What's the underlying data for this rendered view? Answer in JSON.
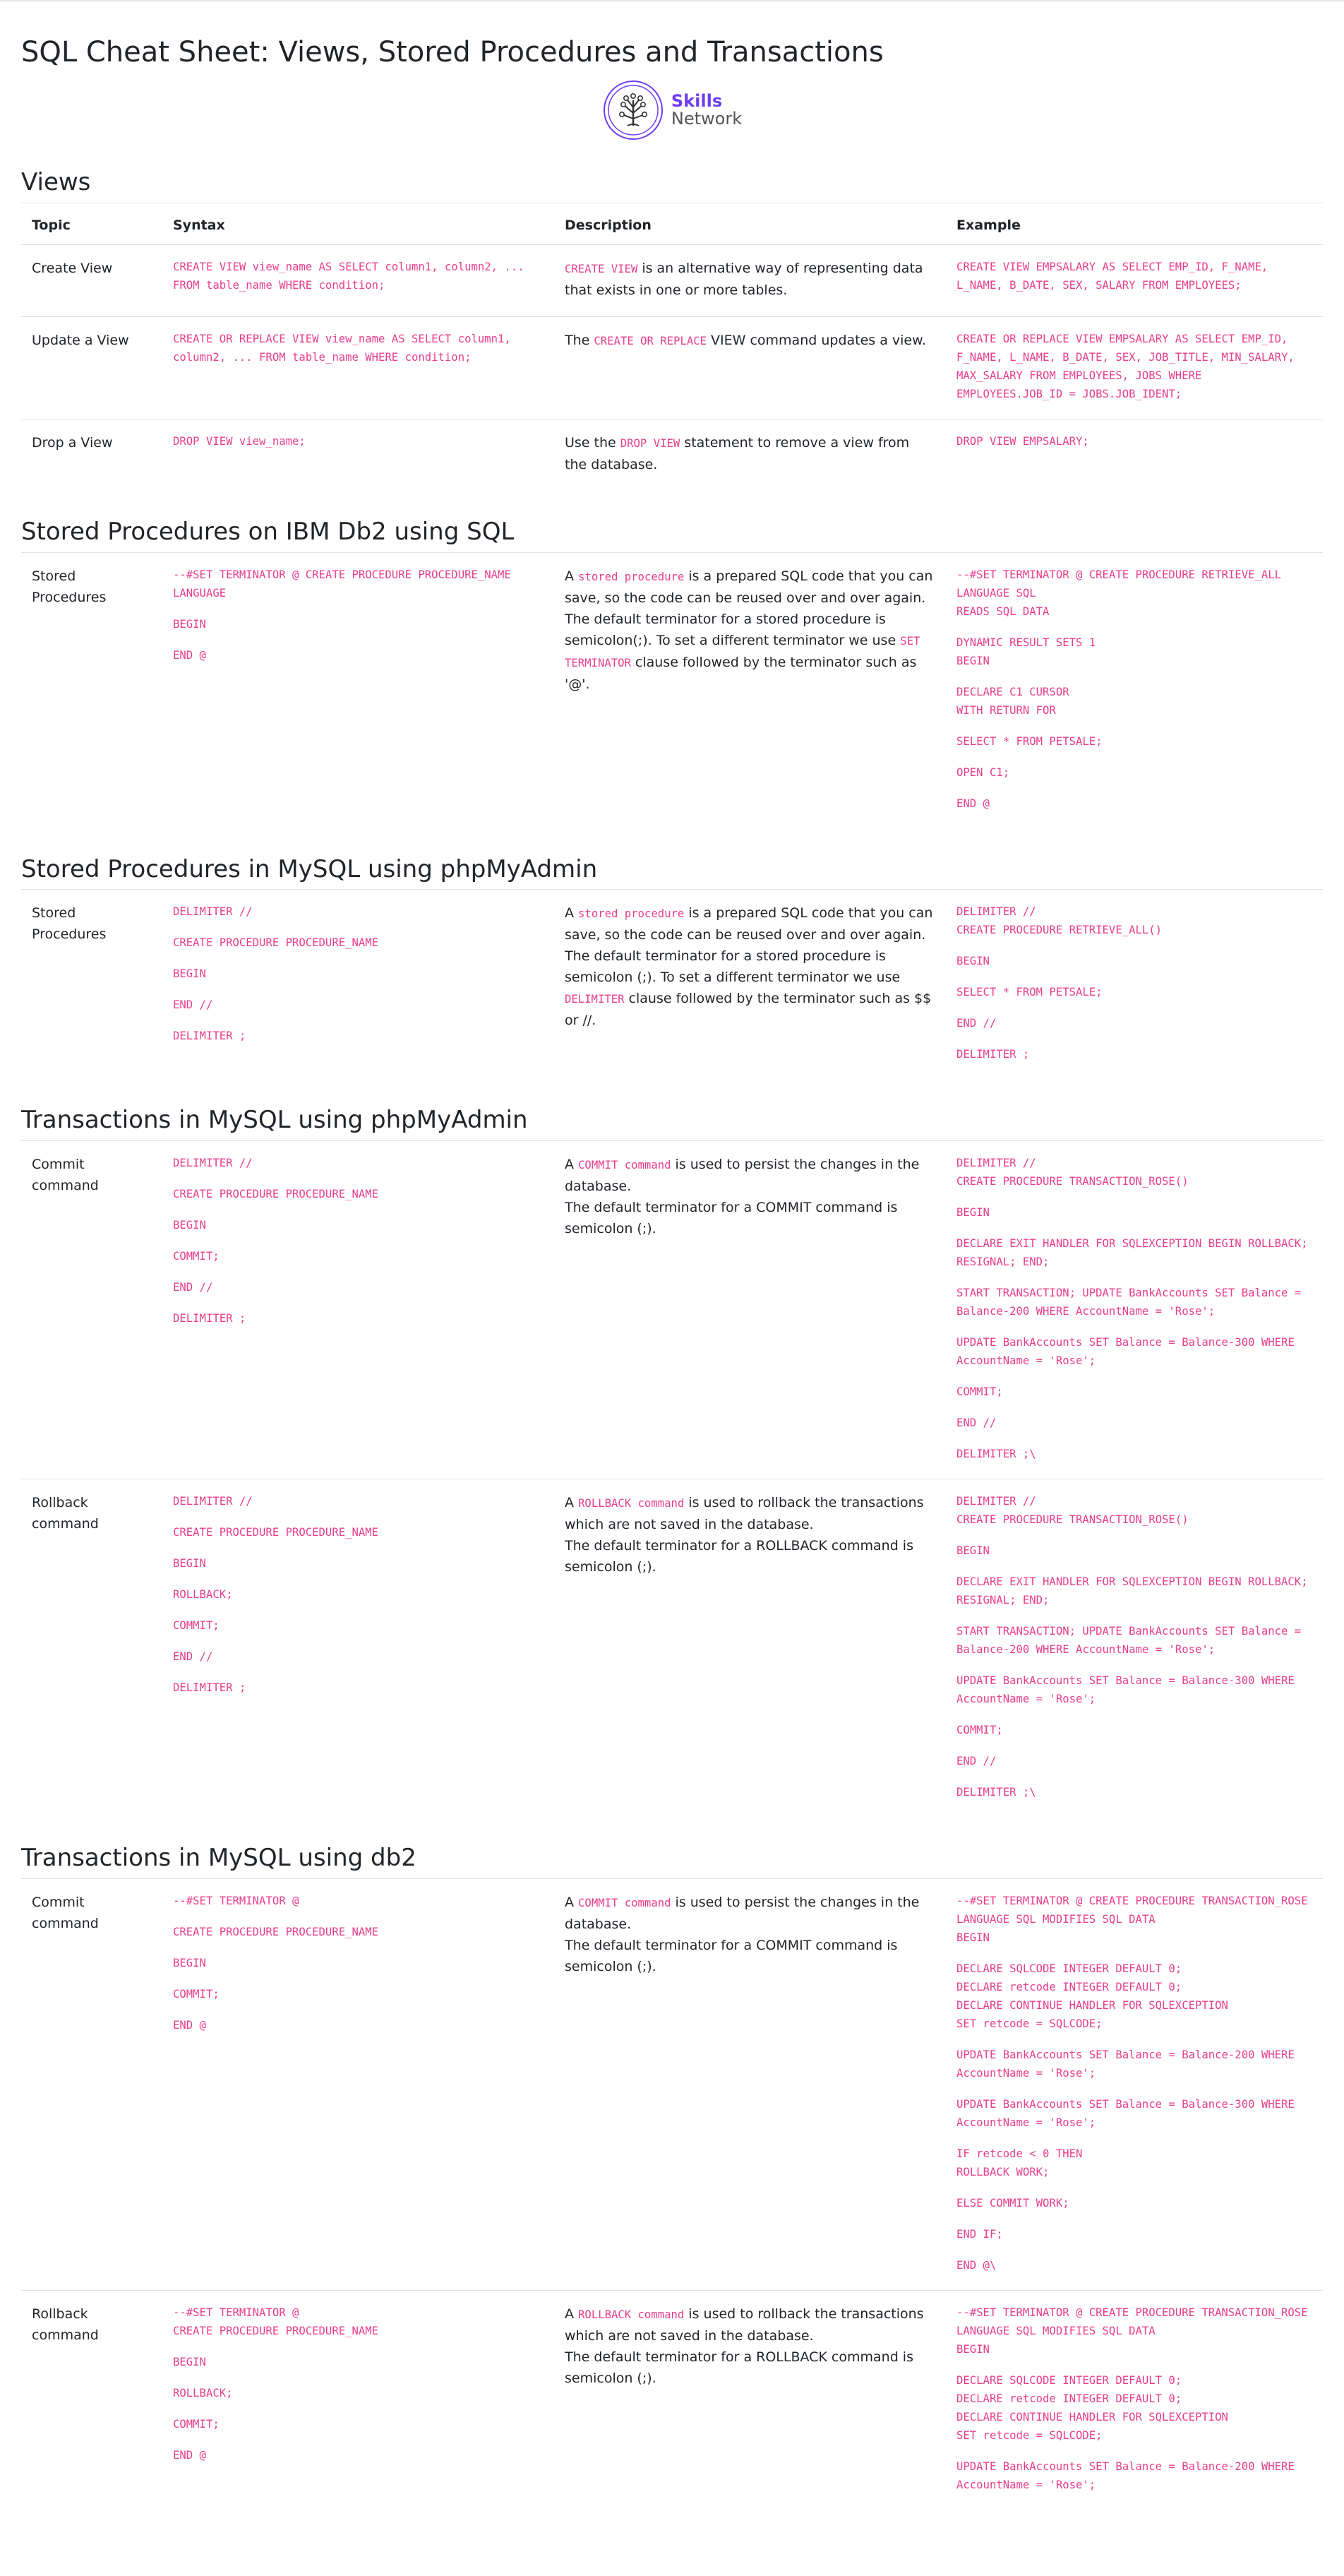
{
  "page": {
    "title": "SQL Cheat Sheet: Views, Stored Procedures and Transactions",
    "logo": {
      "line1": "Skills",
      "line2": "Network",
      "brand_color": "#6f3ef2"
    }
  },
  "table_headers": [
    "Topic",
    "Syntax",
    "Description",
    "Example"
  ],
  "sections": [
    {
      "title": "Views",
      "show_header": true,
      "rows": [
        {
          "topic": "Create View",
          "syntax": [
            [
              "CREATE VIEW view_name AS SELECT column1, column2, ... FROM table_name WHERE condition;"
            ]
          ],
          "desc": [
            [
              "",
              "CREATE VIEW",
              " is an alternative way of representing data that exists in one or more tables."
            ]
          ],
          "example": [
            [
              "CREATE VIEW EMPSALARY AS SELECT EMP_ID, F_NAME, L_NAME, B_DATE, SEX, SALARY FROM EMPLOYEES;"
            ]
          ]
        },
        {
          "topic": "Update a View",
          "syntax": [
            [
              "CREATE OR REPLACE VIEW view_name AS SELECT column1, column2, ... FROM table_name WHERE condition;"
            ]
          ],
          "desc": [
            [
              "The ",
              "CREATE OR REPLACE",
              " VIEW command updates a view."
            ]
          ],
          "example": [
            [
              "CREATE OR REPLACE VIEW EMPSALARY AS SELECT EMP_ID, F_NAME, L_NAME, B_DATE, SEX, JOB_TITLE, MIN_SALARY, MAX_SALARY FROM EMPLOYEES, JOBS WHERE EMPLOYEES.JOB_ID = JOBS.JOB_IDENT;"
            ]
          ]
        },
        {
          "topic": "Drop a View",
          "syntax": [
            [
              "DROP VIEW view_name;"
            ]
          ],
          "desc": [
            [
              "Use the ",
              "DROP VIEW",
              " statement to remove a view from the database."
            ]
          ],
          "example": [
            [
              "DROP VIEW EMPSALARY;"
            ]
          ]
        }
      ]
    },
    {
      "title": "Stored Procedures on IBM Db2 using SQL",
      "show_header": false,
      "rows": [
        {
          "topic": "Stored Procedures",
          "syntax": [
            [
              "--#SET TERMINATOR @ CREATE PROCEDURE PROCEDURE_NAME LANGUAGE"
            ],
            [
              "BEGIN"
            ],
            [
              "END @"
            ]
          ],
          "desc": [
            [
              "A ",
              "stored procedure",
              " is a prepared SQL code that you can save, so the code can be reused over and over again."
            ],
            [
              "The default terminator for a stored procedure is semicolon(;). To set a different terminator we use ",
              "SET TERMINATOR",
              " clause followed by the terminator such as '@'."
            ]
          ],
          "example": [
            [
              "--#SET TERMINATOR @ CREATE PROCEDURE RETRIEVE_ALL",
              "LANGUAGE SQL",
              "READS SQL DATA"
            ],
            [
              "DYNAMIC RESULT SETS 1",
              "BEGIN"
            ],
            [
              "DECLARE C1 CURSOR",
              "WITH RETURN FOR"
            ],
            [
              "SELECT * FROM PETSALE;"
            ],
            [
              "OPEN C1;"
            ],
            [
              "END @"
            ]
          ]
        }
      ]
    },
    {
      "title": "Stored Procedures in MySQL using phpMyAdmin",
      "show_header": false,
      "rows": [
        {
          "topic": "Stored Procedures",
          "syntax": [
            [
              "DELIMITER //"
            ],
            [
              "CREATE PROCEDURE PROCEDURE_NAME"
            ],
            [
              "BEGIN"
            ],
            [
              "END //"
            ],
            [
              "DELIMITER ;"
            ]
          ],
          "desc": [
            [
              "A ",
              "stored procedure",
              " is a prepared SQL code that you can save, so the code can be reused over and over again."
            ],
            [
              "The default terminator for a stored procedure is semicolon (;). To set a different terminator we use ",
              "DELIMITER",
              " clause followed by the terminator such as $$ or //."
            ]
          ],
          "example": [
            [
              "DELIMITER //",
              "CREATE PROCEDURE RETRIEVE_ALL()"
            ],
            [
              "BEGIN"
            ],
            [
              "SELECT * FROM PETSALE;"
            ],
            [
              "END //"
            ],
            [
              "DELIMITER ;"
            ]
          ]
        }
      ]
    },
    {
      "title": "Transactions in MySQL using phpMyAdmin",
      "show_header": false,
      "rows": [
        {
          "topic": "Commit command",
          "syntax": [
            [
              "DELIMITER //"
            ],
            [
              "CREATE PROCEDURE PROCEDURE_NAME"
            ],
            [
              "BEGIN"
            ],
            [
              "COMMIT;"
            ],
            [
              "END //"
            ],
            [
              "DELIMITER ;"
            ]
          ],
          "desc": [
            [
              "A ",
              "COMMIT command",
              " is used to persist the changes in the database."
            ],
            [
              "The default terminator for a COMMIT command is semicolon (;)."
            ]
          ],
          "example": [
            [
              "DELIMITER //",
              "CREATE PROCEDURE TRANSACTION_ROSE()"
            ],
            [
              "BEGIN"
            ],
            [
              "DECLARE EXIT HANDLER FOR SQLEXCEPTION BEGIN ROLLBACK; RESIGNAL; END;"
            ],
            [
              "START TRANSACTION; UPDATE BankAccounts SET Balance = Balance-200 WHERE AccountName = 'Rose';"
            ],
            [
              "UPDATE BankAccounts SET Balance = Balance-300 WHERE AccountName = 'Rose';"
            ],
            [
              "COMMIT;"
            ],
            [
              "END //"
            ],
            [
              "DELIMITER ;\\"
            ]
          ]
        },
        {
          "topic": "Rollback command",
          "syntax": [
            [
              "DELIMITER //"
            ],
            [
              "CREATE PROCEDURE PROCEDURE_NAME"
            ],
            [
              "BEGIN"
            ],
            [
              "ROLLBACK;"
            ],
            [
              "COMMIT;"
            ],
            [
              "END //"
            ],
            [
              "DELIMITER ;"
            ]
          ],
          "desc": [
            [
              "A ",
              "ROLLBACK command",
              " is used to rollback the transactions which are not saved in the database."
            ],
            [
              "The default terminator for a ROLLBACK command is semicolon (;)."
            ]
          ],
          "example": [
            [
              "DELIMITER //",
              "CREATE PROCEDURE TRANSACTION_ROSE()"
            ],
            [
              "BEGIN"
            ],
            [
              "DECLARE EXIT HANDLER FOR SQLEXCEPTION BEGIN ROLLBACK; RESIGNAL; END;"
            ],
            [
              "START TRANSACTION; UPDATE BankAccounts SET Balance = Balance-200 WHERE AccountName = 'Rose';"
            ],
            [
              "UPDATE BankAccounts SET Balance = Balance-300 WHERE AccountName = 'Rose';"
            ],
            [
              "COMMIT;"
            ],
            [
              "END //"
            ],
            [
              "DELIMITER ;\\"
            ]
          ]
        }
      ]
    },
    {
      "title": "Transactions in MySQL using db2",
      "show_header": false,
      "rows": [
        {
          "topic": "Commit command",
          "syntax": [
            [
              "--#SET TERMINATOR @"
            ],
            [
              "CREATE PROCEDURE PROCEDURE_NAME"
            ],
            [
              "BEGIN"
            ],
            [
              "COMMIT;"
            ],
            [
              "END @"
            ]
          ],
          "desc": [
            [
              "A ",
              "COMMIT command",
              " is used to persist the changes in the database."
            ],
            [
              "The default terminator for a COMMIT command is semicolon (;)."
            ]
          ],
          "example": [
            [
              "--#SET TERMINATOR @ CREATE PROCEDURE TRANSACTION_ROSE",
              "LANGUAGE SQL MODIFIES SQL DATA",
              "BEGIN"
            ],
            [
              "DECLARE SQLCODE INTEGER DEFAULT 0;",
              "DECLARE retcode INTEGER DEFAULT 0;",
              "DECLARE CONTINUE HANDLER FOR SQLEXCEPTION",
              "SET retcode = SQLCODE;"
            ],
            [
              "UPDATE BankAccounts SET Balance = Balance-200 WHERE AccountName = 'Rose';"
            ],
            [
              "UPDATE BankAccounts SET Balance = Balance-300 WHERE AccountName = 'Rose';"
            ],
            [
              "IF retcode < 0 THEN",
              "ROLLBACK WORK;"
            ],
            [
              "ELSE COMMIT WORK;"
            ],
            [
              "END IF;"
            ],
            [
              "END @\\"
            ]
          ]
        },
        {
          "topic": "Rollback command",
          "syntax": [
            [
              "--#SET TERMINATOR @",
              "CREATE PROCEDURE PROCEDURE_NAME"
            ],
            [
              "BEGIN"
            ],
            [
              "ROLLBACK;"
            ],
            [
              "COMMIT;"
            ],
            [
              "END @"
            ]
          ],
          "desc": [
            [
              "A ",
              "ROLLBACK command",
              " is used to rollback the transactions which are not saved in the database."
            ],
            [
              "The default terminator for a ROLLBACK command is semicolon (;)."
            ]
          ],
          "example": [
            [
              "--#SET TERMINATOR @ CREATE PROCEDURE TRANSACTION_ROSE",
              "LANGUAGE SQL MODIFIES SQL DATA",
              "BEGIN"
            ],
            [
              "DECLARE SQLCODE INTEGER DEFAULT 0;",
              "DECLARE retcode INTEGER DEFAULT 0;",
              "DECLARE CONTINUE HANDLER FOR SQLEXCEPTION",
              "SET retcode = SQLCODE;"
            ],
            [
              "UPDATE BankAccounts SET Balance = Balance-200 WHERE AccountName = 'Rose';"
            ]
          ]
        }
      ]
    }
  ]
}
